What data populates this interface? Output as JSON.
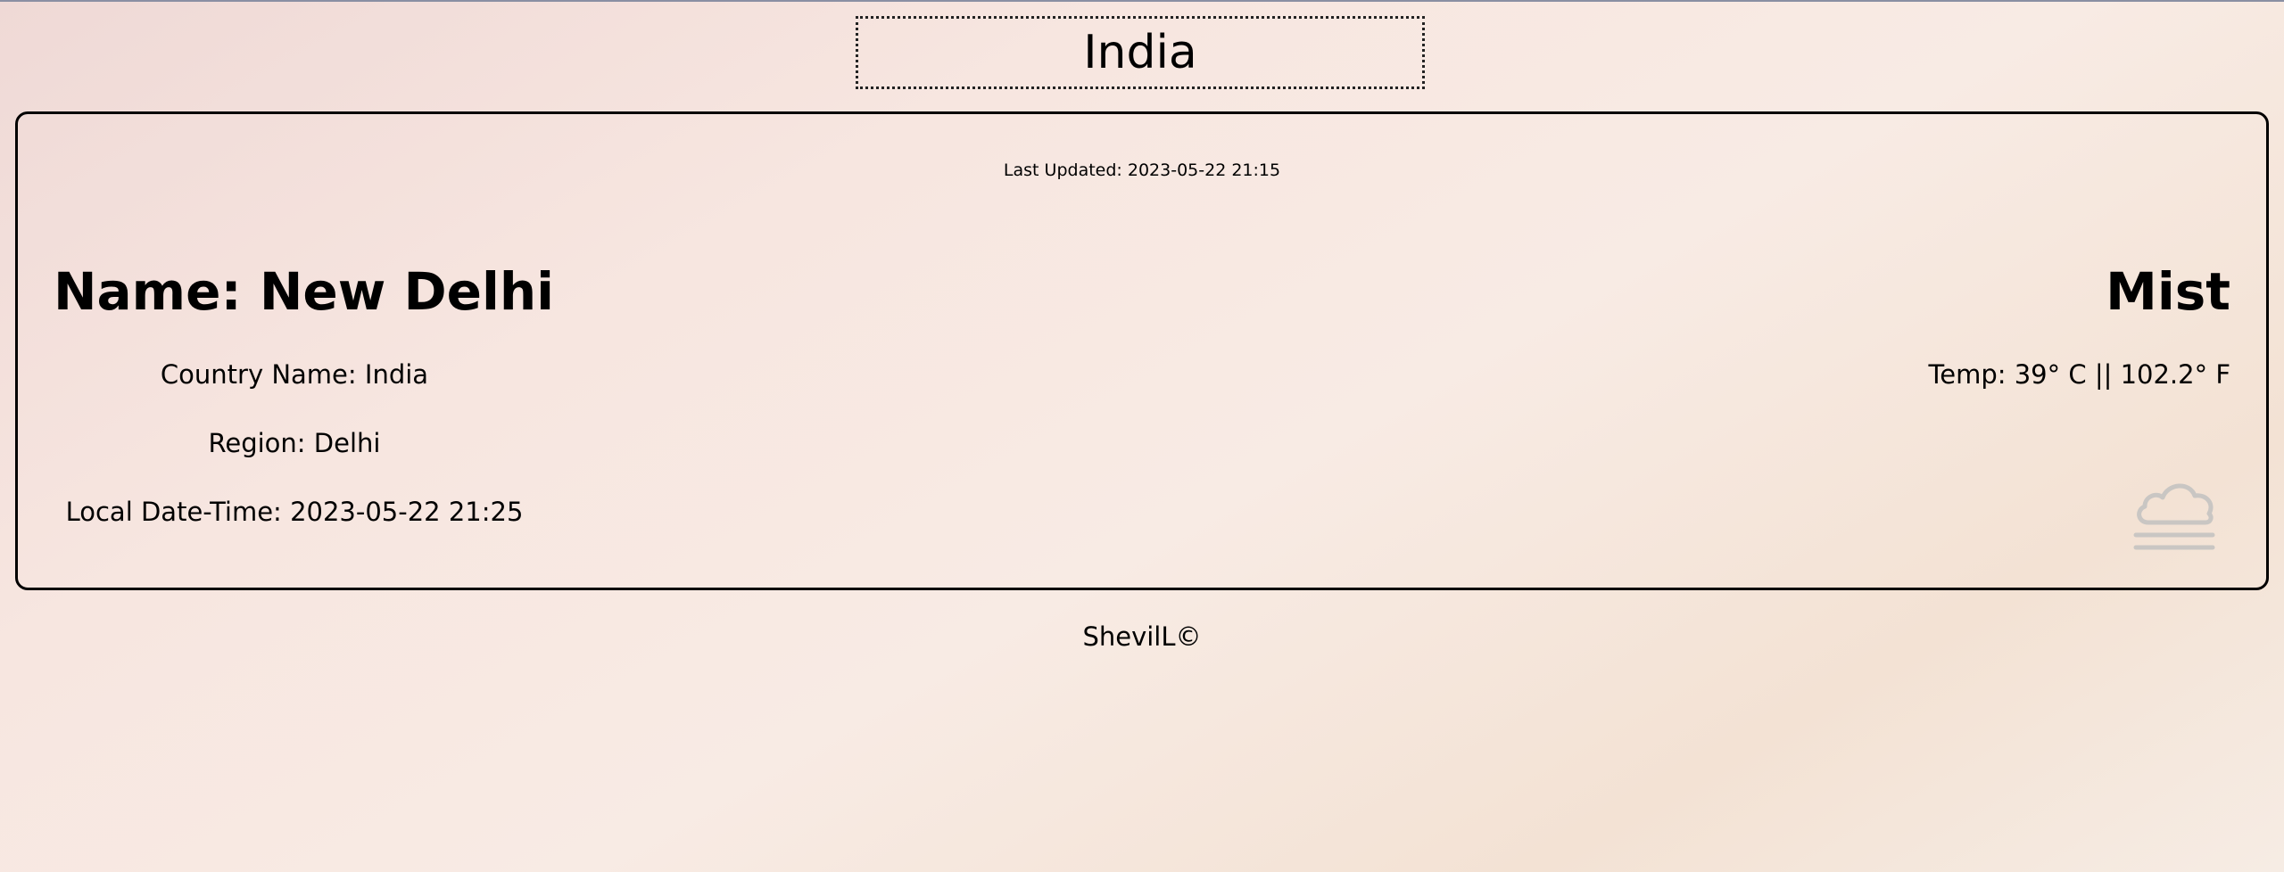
{
  "header": {
    "country": "India"
  },
  "card": {
    "last_updated_label": "Last Updated:",
    "last_updated_value": "2023-05-22 21:15",
    "location": {
      "name_label": "Name:",
      "name": "New Delhi",
      "country_label": "Country Name:",
      "country": "India",
      "region_label": "Region:",
      "region": "Delhi",
      "localtime_label": "Local Date-Time:",
      "localtime": "2023-05-22 21:25"
    },
    "weather": {
      "condition": "Mist",
      "temp_label": "Temp:",
      "temp_c": "39° C",
      "separator": "||",
      "temp_f": "102.2° F",
      "icon": "mist-cloud-icon",
      "icon_color": "#c9c6c3"
    }
  },
  "footer": {
    "text": "ShevilL©"
  }
}
